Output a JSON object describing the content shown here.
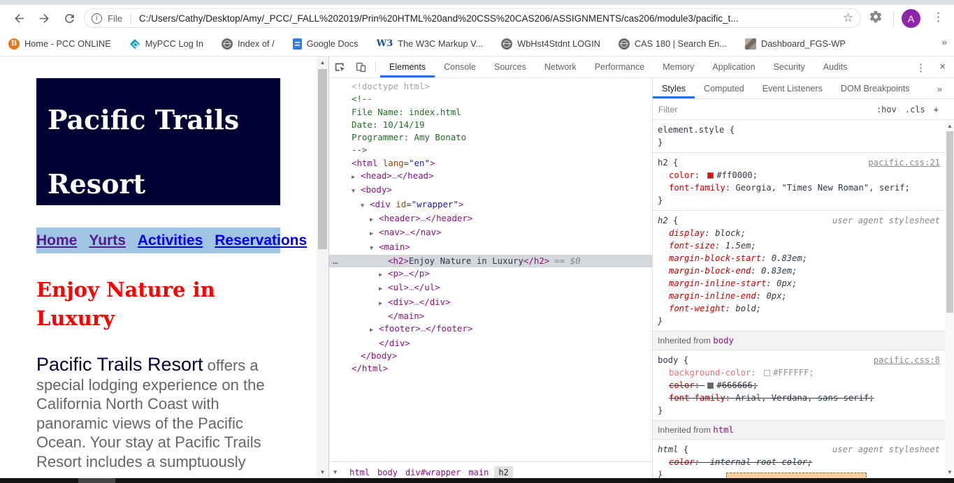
{
  "browser": {
    "scheme_label": "File",
    "url": "C:/Users/Cathy/Desktop/Amy/_PCC/_FALL%202019/Prin%20HTML%20and%20CSS%20CAS206/ASSIGNMENTS/cas206/module3/pacific_t...",
    "star_icon": "☆",
    "menu_icon": "⋮",
    "info_icon": "i",
    "avatar_letter": "A",
    "bookmarks_overflow_icon": "»",
    "bookmarks": [
      {
        "label": "Home - PCC ONLINE",
        "icon": "pcc",
        "glyph": "B"
      },
      {
        "label": "MyPCC Log In",
        "icon": "mypcc",
        "glyph": ""
      },
      {
        "label": "Index of /",
        "icon": "globe",
        "glyph": ""
      },
      {
        "label": "Google Docs",
        "icon": "gdocs",
        "glyph": ""
      },
      {
        "label": "The W3C Markup V...",
        "icon": "w3c",
        "glyph": "W3"
      },
      {
        "label": "WbHst4Stdnt LOGIN",
        "icon": "globe",
        "glyph": ""
      },
      {
        "label": "CAS 180 | Search En...",
        "icon": "globe",
        "glyph": ""
      },
      {
        "label": "Dashboard_FGS-WP",
        "icon": "img",
        "glyph": ""
      }
    ]
  },
  "page": {
    "site_title": "Pacific Trails\nResort",
    "nav_links": [
      {
        "label": "Home",
        "visited": true
      },
      {
        "label": "Yurts",
        "visited": true
      },
      {
        "label": "Activities",
        "visited": false
      },
      {
        "label": "Reservations",
        "visited": false
      }
    ],
    "heading": "Enjoy Nature in Luxury",
    "paragraph_lead": "Pacific Trails Resort",
    "paragraph_rest": " offers a special lodging experience on the California North Coast with panoramic views of the Pacific Ocean. Your stay at Pacific Trails Resort includes a sumptuously",
    "colors": {
      "header_bg": "#000033",
      "nav_bg": "#A0C5E4",
      "heading": "#FF0000",
      "body_text": "#666666",
      "link": "#0000EE",
      "link_visited": "#551A8B"
    }
  },
  "devtools": {
    "tabs": [
      "Elements",
      "Console",
      "Sources",
      "Network",
      "Performance",
      "Memory",
      "Application",
      "Security",
      "Audits"
    ],
    "active_tab": "Elements",
    "more_icon": "⋮",
    "close_icon": "×",
    "breadcrumb_caret": "▼",
    "breadcrumbs": [
      "html",
      "body",
      "div#wrapper",
      "main",
      "h2"
    ],
    "code": [
      {
        "i": 1,
        "arrow": "",
        "sel": false,
        "seg": [
          [
            "d",
            "<!doctype html>"
          ]
        ]
      },
      {
        "i": 1,
        "arrow": "",
        "sel": false,
        "seg": [
          [
            "c",
            "<!--"
          ]
        ]
      },
      {
        "i": 1,
        "arrow": "",
        "sel": false,
        "seg": [
          [
            "c",
            "File Name: index.html"
          ]
        ]
      },
      {
        "i": 1,
        "arrow": "",
        "sel": false,
        "seg": [
          [
            "c",
            "Date: 10/14/19"
          ]
        ]
      },
      {
        "i": 1,
        "arrow": "",
        "sel": false,
        "seg": [
          [
            "c",
            "Programmer: Amy Bonato"
          ]
        ]
      },
      {
        "i": 1,
        "arrow": "",
        "sel": false,
        "seg": [
          [
            "c",
            "-->"
          ]
        ]
      },
      {
        "i": 1,
        "arrow": "",
        "sel": false,
        "seg": [
          [
            "g",
            "<html"
          ],
          [
            "a",
            " lang"
          ],
          [
            "x",
            "="
          ],
          [
            "v",
            "\"en\""
          ],
          [
            "g",
            ">"
          ]
        ]
      },
      {
        "i": 2,
        "arrow": "▶",
        "sel": false,
        "seg": [
          [
            "g",
            "<head>"
          ],
          [
            "m",
            "…"
          ],
          [
            "g",
            "</head>"
          ]
        ]
      },
      {
        "i": 2,
        "arrow": "▼",
        "sel": false,
        "seg": [
          [
            "g",
            "<body>"
          ]
        ]
      },
      {
        "i": 3,
        "arrow": "▼",
        "sel": false,
        "seg": [
          [
            "g",
            "<div"
          ],
          [
            "a",
            " id"
          ],
          [
            "x",
            "="
          ],
          [
            "v",
            "\"wrapper\""
          ],
          [
            "g",
            ">"
          ]
        ]
      },
      {
        "i": 4,
        "arrow": "▶",
        "sel": false,
        "seg": [
          [
            "g",
            "<header>"
          ],
          [
            "m",
            "…"
          ],
          [
            "g",
            "</header>"
          ]
        ]
      },
      {
        "i": 4,
        "arrow": "▶",
        "sel": false,
        "seg": [
          [
            "g",
            "<nav>"
          ],
          [
            "m",
            "…"
          ],
          [
            "g",
            "</nav>"
          ]
        ]
      },
      {
        "i": 4,
        "arrow": "▼",
        "sel": false,
        "seg": [
          [
            "g",
            "<main>"
          ]
        ]
      },
      {
        "i": 5,
        "arrow": "",
        "sel": true,
        "suf": "== $0",
        "seg": [
          [
            "g",
            "<h2>"
          ],
          [
            "x",
            "Enjoy Nature in Luxury"
          ],
          [
            "g",
            "</h2>"
          ]
        ]
      },
      {
        "i": 5,
        "arrow": "▶",
        "sel": false,
        "seg": [
          [
            "g",
            "<p>"
          ],
          [
            "m",
            "…"
          ],
          [
            "g",
            "</p>"
          ]
        ]
      },
      {
        "i": 5,
        "arrow": "▶",
        "sel": false,
        "seg": [
          [
            "g",
            "<ul>"
          ],
          [
            "m",
            "…"
          ],
          [
            "g",
            "</ul>"
          ]
        ]
      },
      {
        "i": 5,
        "arrow": "▶",
        "sel": false,
        "seg": [
          [
            "g",
            "<div>"
          ],
          [
            "m",
            "…"
          ],
          [
            "g",
            "</div>"
          ]
        ]
      },
      {
        "i": 5,
        "arrow": "",
        "sel": false,
        "seg": [
          [
            "g",
            "</main>"
          ]
        ]
      },
      {
        "i": 4,
        "arrow": "▶",
        "sel": false,
        "seg": [
          [
            "g",
            "<footer>"
          ],
          [
            "m",
            "…"
          ],
          [
            "g",
            "</footer>"
          ]
        ]
      },
      {
        "i": 4,
        "arrow": "",
        "sel": false,
        "seg": [
          [
            "g",
            "</div>"
          ]
        ]
      },
      {
        "i": 2,
        "arrow": "",
        "sel": false,
        "seg": [
          [
            "g",
            "</body>"
          ]
        ]
      },
      {
        "i": 1,
        "arrow": "",
        "sel": false,
        "seg": [
          [
            "g",
            "</html>"
          ]
        ]
      }
    ],
    "sidebar": {
      "tabs": [
        "Styles",
        "Computed",
        "Event Listeners",
        "DOM Breakpoints"
      ],
      "active_tab": "Styles",
      "overflow_icon": "»",
      "filter_placeholder": "Filter",
      "controls": [
        ":hov",
        ".cls",
        "+"
      ],
      "rules": [
        {
          "selector": "element.style",
          "origin": "",
          "props": []
        },
        {
          "selector": "h2",
          "origin": "pacific.css:21",
          "origin_link": true,
          "props": [
            {
              "name": "color",
              "value": "#ff0000",
              "swatch": "#ff0000"
            },
            {
              "name": "font-family",
              "value": "Georgia, \"Times New Roman\", serif"
            }
          ]
        },
        {
          "selector": "h2",
          "origin": "user agent stylesheet",
          "ua": true,
          "props": [
            {
              "name": "display",
              "value": "block"
            },
            {
              "name": "font-size",
              "value": "1.5em"
            },
            {
              "name": "margin-block-start",
              "value": "0.83em"
            },
            {
              "name": "margin-block-end",
              "value": "0.83em"
            },
            {
              "name": "margin-inline-start",
              "value": "0px"
            },
            {
              "name": "margin-inline-end",
              "value": "0px"
            },
            {
              "name": "font-weight",
              "value": "bold"
            }
          ]
        },
        {
          "section": "Inherited from ",
          "section_el": "body"
        },
        {
          "selector": "body",
          "origin": "pacific.css:8",
          "origin_link": true,
          "props": [
            {
              "name": "background-color",
              "value": "#FFFFFF",
              "swatch": "#FFFFFF",
              "faded": true
            },
            {
              "name": "color",
              "value": "#666666",
              "swatch": "#666666",
              "struck": true
            },
            {
              "name": "font-family",
              "value": "Arial, Verdana, sans-serif",
              "struck": true
            }
          ]
        },
        {
          "section": "Inherited from ",
          "section_el": "html"
        },
        {
          "selector": "html",
          "origin": "user agent stylesheet",
          "ua": true,
          "props": [
            {
              "name": "color",
              "value": "-internal-root-color",
              "struck": true
            }
          ]
        }
      ]
    }
  }
}
